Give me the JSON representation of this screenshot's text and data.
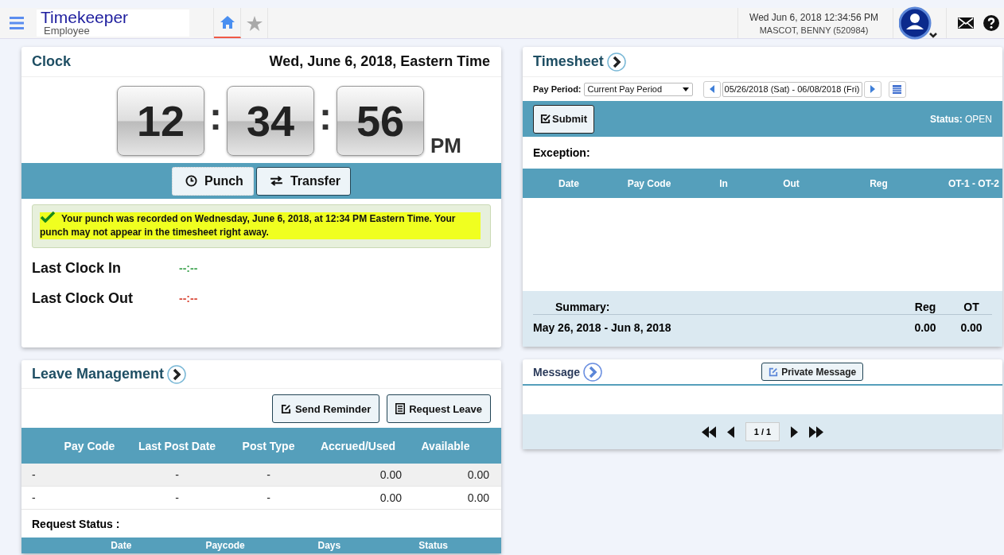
{
  "header": {
    "app_title": "Timekeeper",
    "app_subtitle": "Employee",
    "nav_tabs": [
      {
        "kind": "home",
        "selected": true
      },
      {
        "kind": "star",
        "selected": false
      }
    ],
    "datetime": "Wed Jun 6, 2018 12:34:56 PM",
    "user": "MASCOT, BENNY (520984)"
  },
  "clock": {
    "title": "Clock",
    "date": "Wed, June 6, 2018, Eastern Time",
    "digits": [
      "12",
      "34",
      "56"
    ],
    "separators": [
      ":",
      ":"
    ],
    "ampm": "PM",
    "buttons": [
      {
        "label": "Punch",
        "kind": "clock",
        "selected": true
      },
      {
        "label": "Transfer",
        "kind": "transfer",
        "selected": false
      }
    ],
    "message": "Your punch was recorded on Wednesday, June 6, 2018, at 12:34 PM Eastern Time. Your punch may not appear in the timesheet right away.",
    "last_clock": [
      {
        "label": "Last Clock In",
        "value": "--:--",
        "kind": "in"
      },
      {
        "label": "Last Clock Out",
        "value": "--:--",
        "kind": "out"
      }
    ]
  },
  "timesheet": {
    "title": "Timesheet",
    "pay_period_label": "Pay Period:",
    "pay_period_value": "Current Pay Period",
    "date_range": "05/26/2018 (Sat) - 06/08/2018 (Fri)",
    "submit": "Submit",
    "status_label": "Status:",
    "status_value": "OPEN",
    "exception_label": "Exception:",
    "columns": [
      "Date",
      "Pay Code",
      "In",
      "Out",
      "Reg",
      "OT-1 - OT-2"
    ],
    "summary": {
      "label": "Summary:",
      "columns": [
        "Reg",
        "OT"
      ],
      "period": "May 26, 2018 - Jun 8, 2018",
      "values": [
        "0.00",
        "0.00"
      ]
    }
  },
  "leave": {
    "title": "Leave Management",
    "buttons": [
      {
        "label": "Send Reminder",
        "kind": "edit"
      },
      {
        "label": "Request Leave",
        "kind": "list"
      }
    ],
    "columns": [
      "Pay Code",
      "Last Post Date",
      "Post Type",
      "Accrued/Used",
      "Available"
    ],
    "rows": [
      [
        "-",
        "-",
        "-",
        "0.00",
        "0.00"
      ],
      [
        "-",
        "-",
        "-",
        "0.00",
        "0.00"
      ]
    ],
    "request_status_label": "Request Status :",
    "request_columns": [
      "Date",
      "Paycode",
      "Days",
      "Status"
    ]
  },
  "message": {
    "title": "Message",
    "button": "Private Message",
    "page": "1 / 1"
  }
}
